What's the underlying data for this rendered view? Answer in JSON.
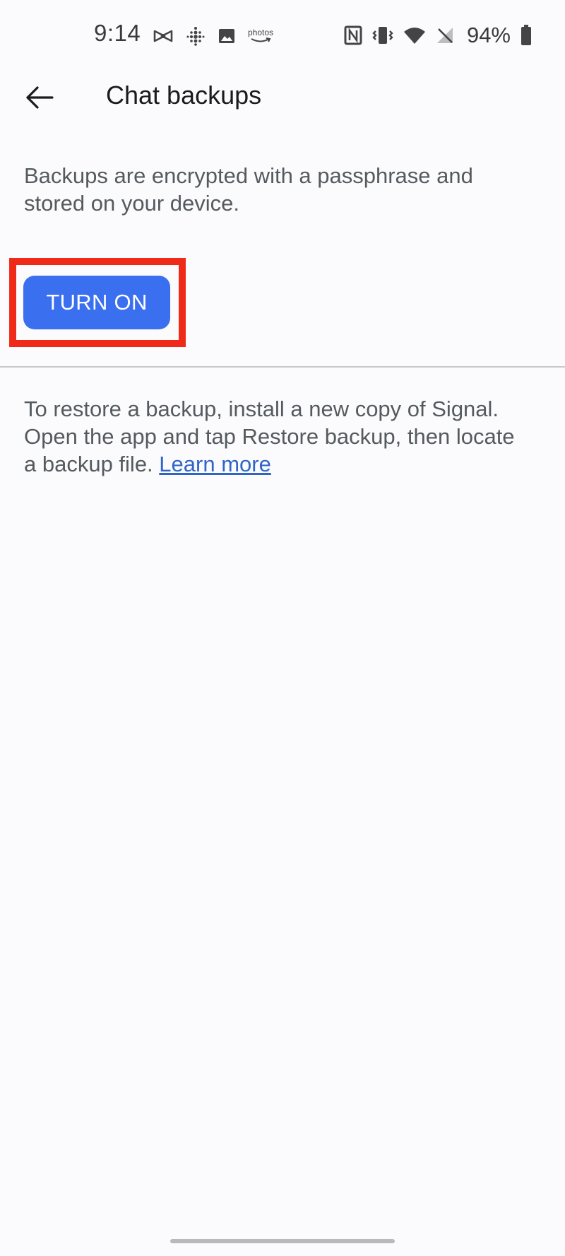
{
  "status_bar": {
    "time": "9:14",
    "left_icons": [
      "bowtie-icon",
      "fitbit-icon",
      "image-icon",
      "amazon-photos-icon"
    ],
    "photos_label": "photos",
    "right_icons": [
      "nfc-icon",
      "vibrate-icon",
      "wifi-icon",
      "no-signal-icon",
      "battery-icon"
    ],
    "battery_percent": "94%"
  },
  "app_bar": {
    "back_icon": "arrow-left-icon",
    "title": "Chat backups"
  },
  "main": {
    "description": "Backups are encrypted with a passphrase and stored on your device.",
    "turn_on_label": "TURN ON",
    "restore_text": "To restore a backup, install a new copy of Signal. Open the app and tap Restore backup, then locate a backup file. ",
    "learn_more_label": "Learn more"
  },
  "colors": {
    "accent": "#3a6ff0",
    "highlight": "#f02a18",
    "link": "#2f65c7"
  }
}
